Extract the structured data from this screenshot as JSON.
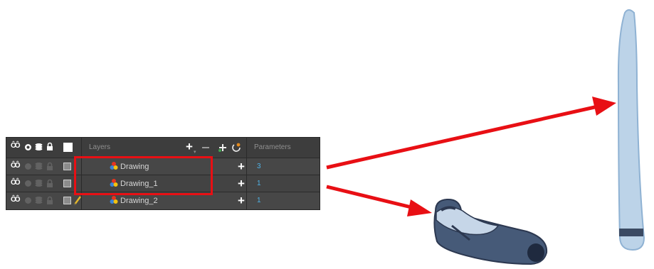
{
  "header": {
    "layers_label": "Layers",
    "parameters_label": "Parameters"
  },
  "layers": [
    {
      "name": "Drawing",
      "param": "3"
    },
    {
      "name": "Drawing_1",
      "param": "1"
    },
    {
      "name": "Drawing_2",
      "param": "1"
    }
  ],
  "colors": {
    "annotation": "#e80f14",
    "panel": "#3a3a3a",
    "param_text": "#4fb3e6"
  },
  "icons": [
    "show-all-icon",
    "eye-icon",
    "lock-icon",
    "color-swatch-icon",
    "add-layer-icon",
    "delete-layer-icon",
    "add-peg-icon",
    "drawing-layer-icon",
    "pencil-icon"
  ]
}
